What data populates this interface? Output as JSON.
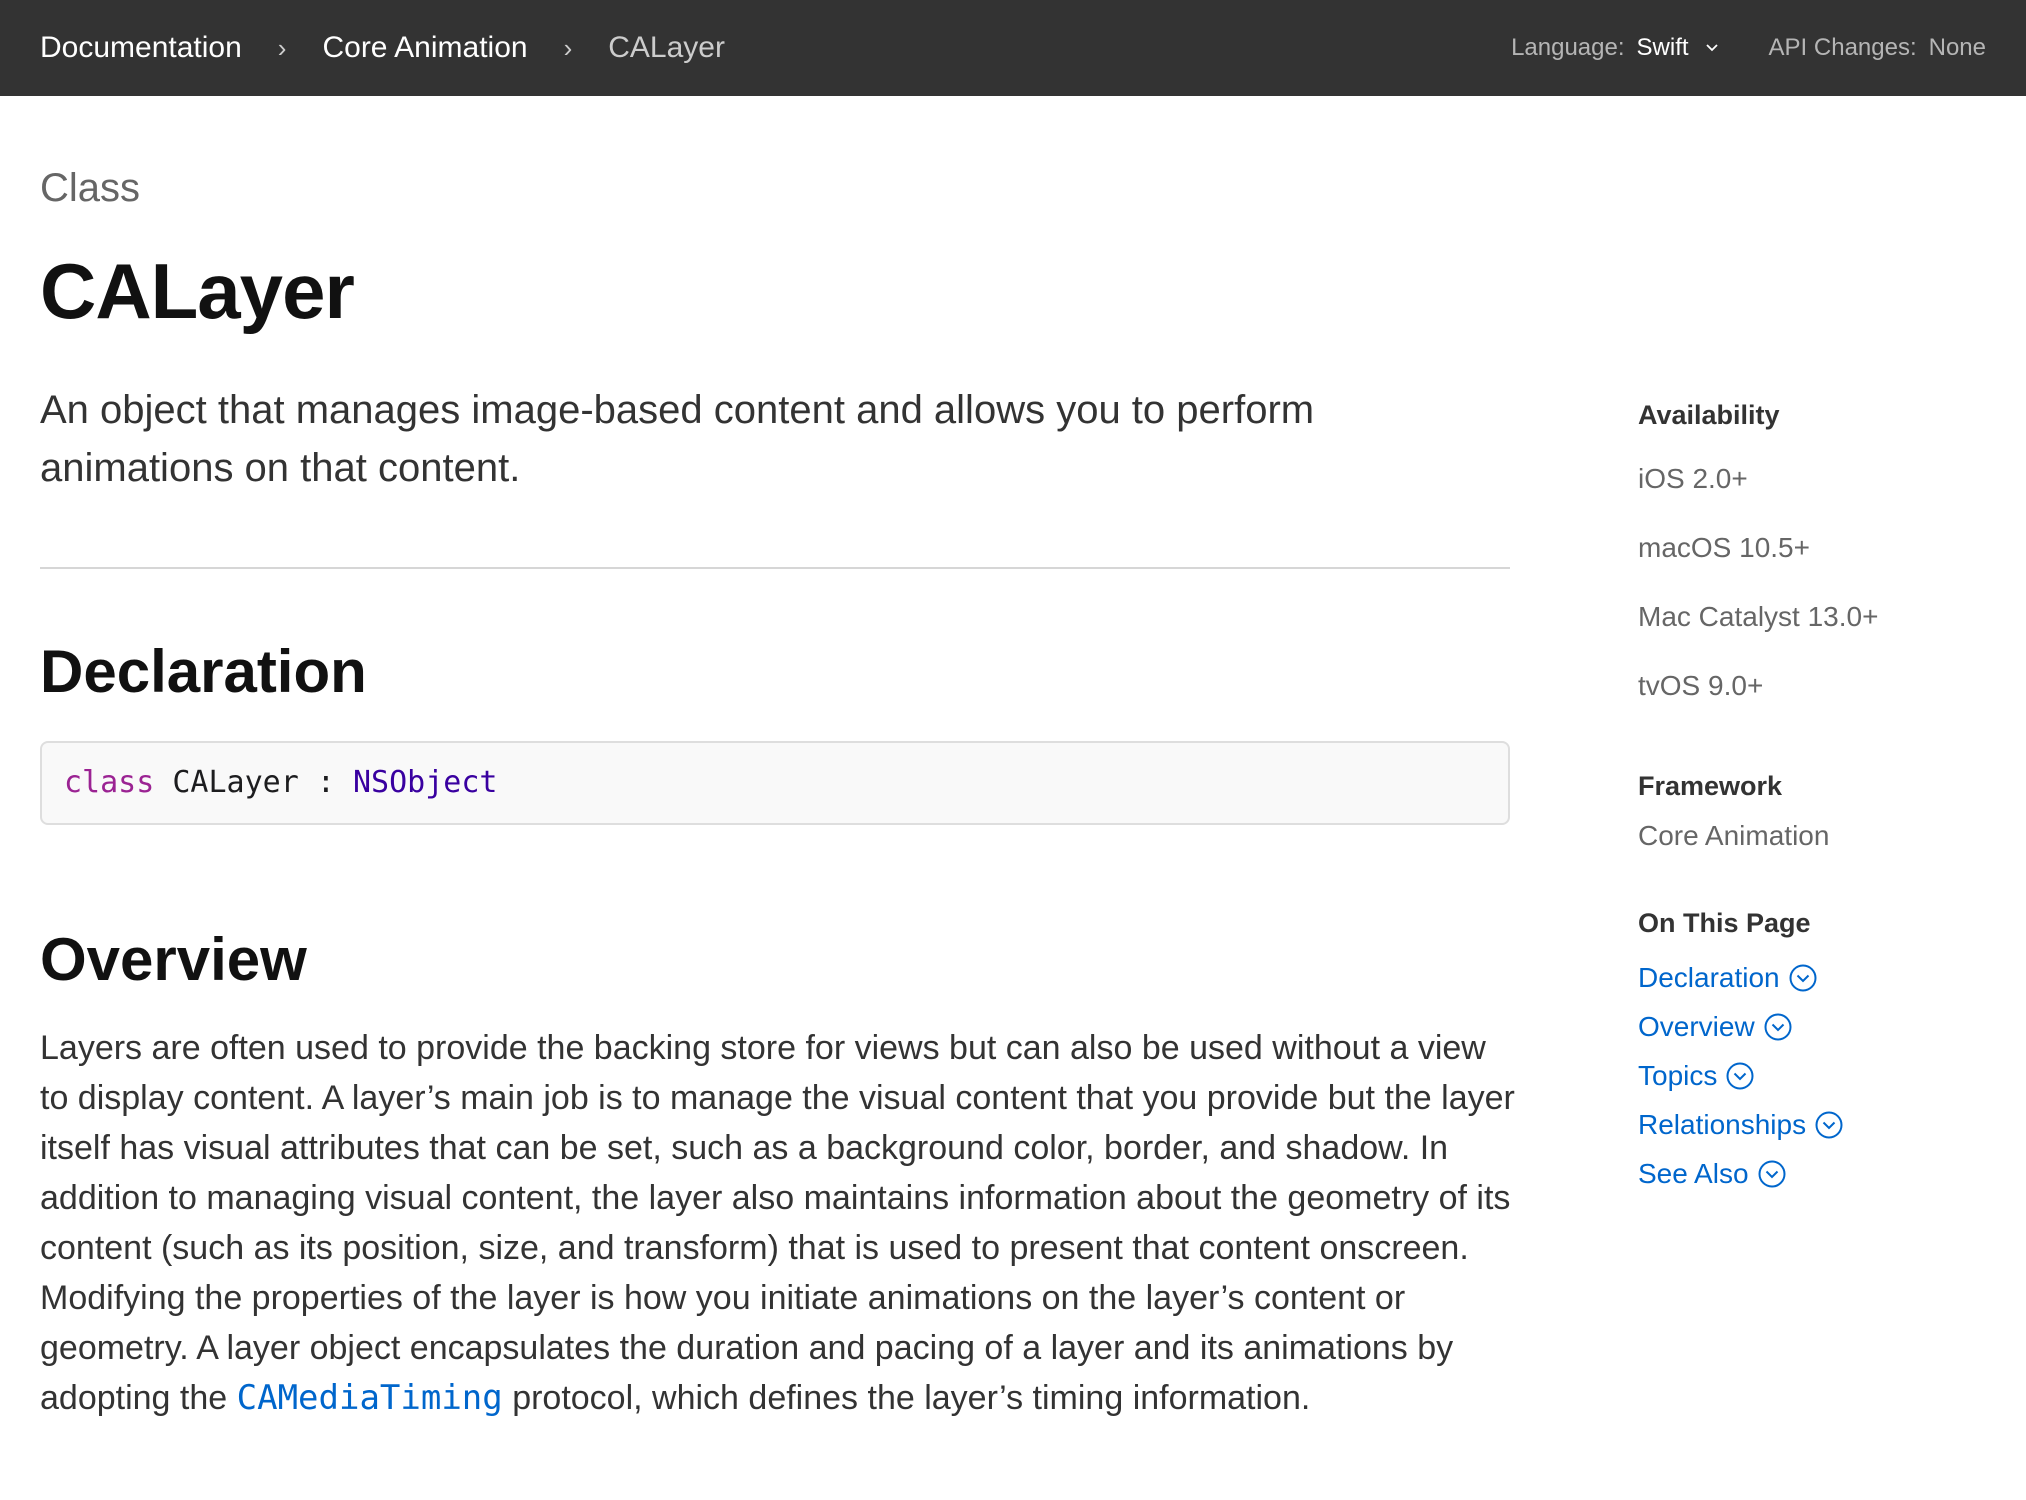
{
  "nav": {
    "breadcrumbs": [
      {
        "label": "Documentation"
      },
      {
        "label": "Core Animation"
      },
      {
        "label": "CALayer"
      }
    ],
    "language_label": "Language:",
    "language_value": "Swift",
    "api_changes_label": "API Changes:",
    "api_changes_value": "None"
  },
  "header": {
    "eyebrow": "Class",
    "title": "CALayer",
    "abstract": "An object that manages image-based content and allows you to perform animations on that content."
  },
  "declaration": {
    "heading": "Declaration",
    "keyword": "class",
    "name": "CALayer",
    "colon": ":",
    "superclass": "NSObject"
  },
  "overview": {
    "heading": "Overview",
    "text_before": "Layers are often used to provide the backing store for views but can also be used without a view to display content. A layer’s main job is to manage the visual content that you provide but the layer itself has visual attributes that can be set, such as a background color, border, and shadow. In addition to managing visual content, the layer also maintains information about the geometry of its content (such as its position, size, and transform) that is used to present that content onscreen. Modifying the properties of the layer is how you initiate animations on the layer’s content or geometry. A layer object encapsulates the duration and pacing of a layer and its animations by adopting the",
    "link_text": "CAMediaTiming",
    "text_after": "protocol, which defines the layer’s timing information."
  },
  "sidebar": {
    "availability_heading": "Availability",
    "availability": [
      "iOS 2.0+",
      "macOS 10.5+",
      "Mac Catalyst 13.0+",
      "tvOS 9.0+"
    ],
    "framework_heading": "Framework",
    "framework": "Core Animation",
    "on_this_page_heading": "On This Page",
    "on_this_page": [
      "Declaration",
      "Overview",
      "Topics",
      "Relationships",
      "See Also"
    ]
  },
  "colors": {
    "topbar_bg": "#333333",
    "link": "#0066cc",
    "keyword": "#9b2393",
    "type": "#3900a0"
  }
}
